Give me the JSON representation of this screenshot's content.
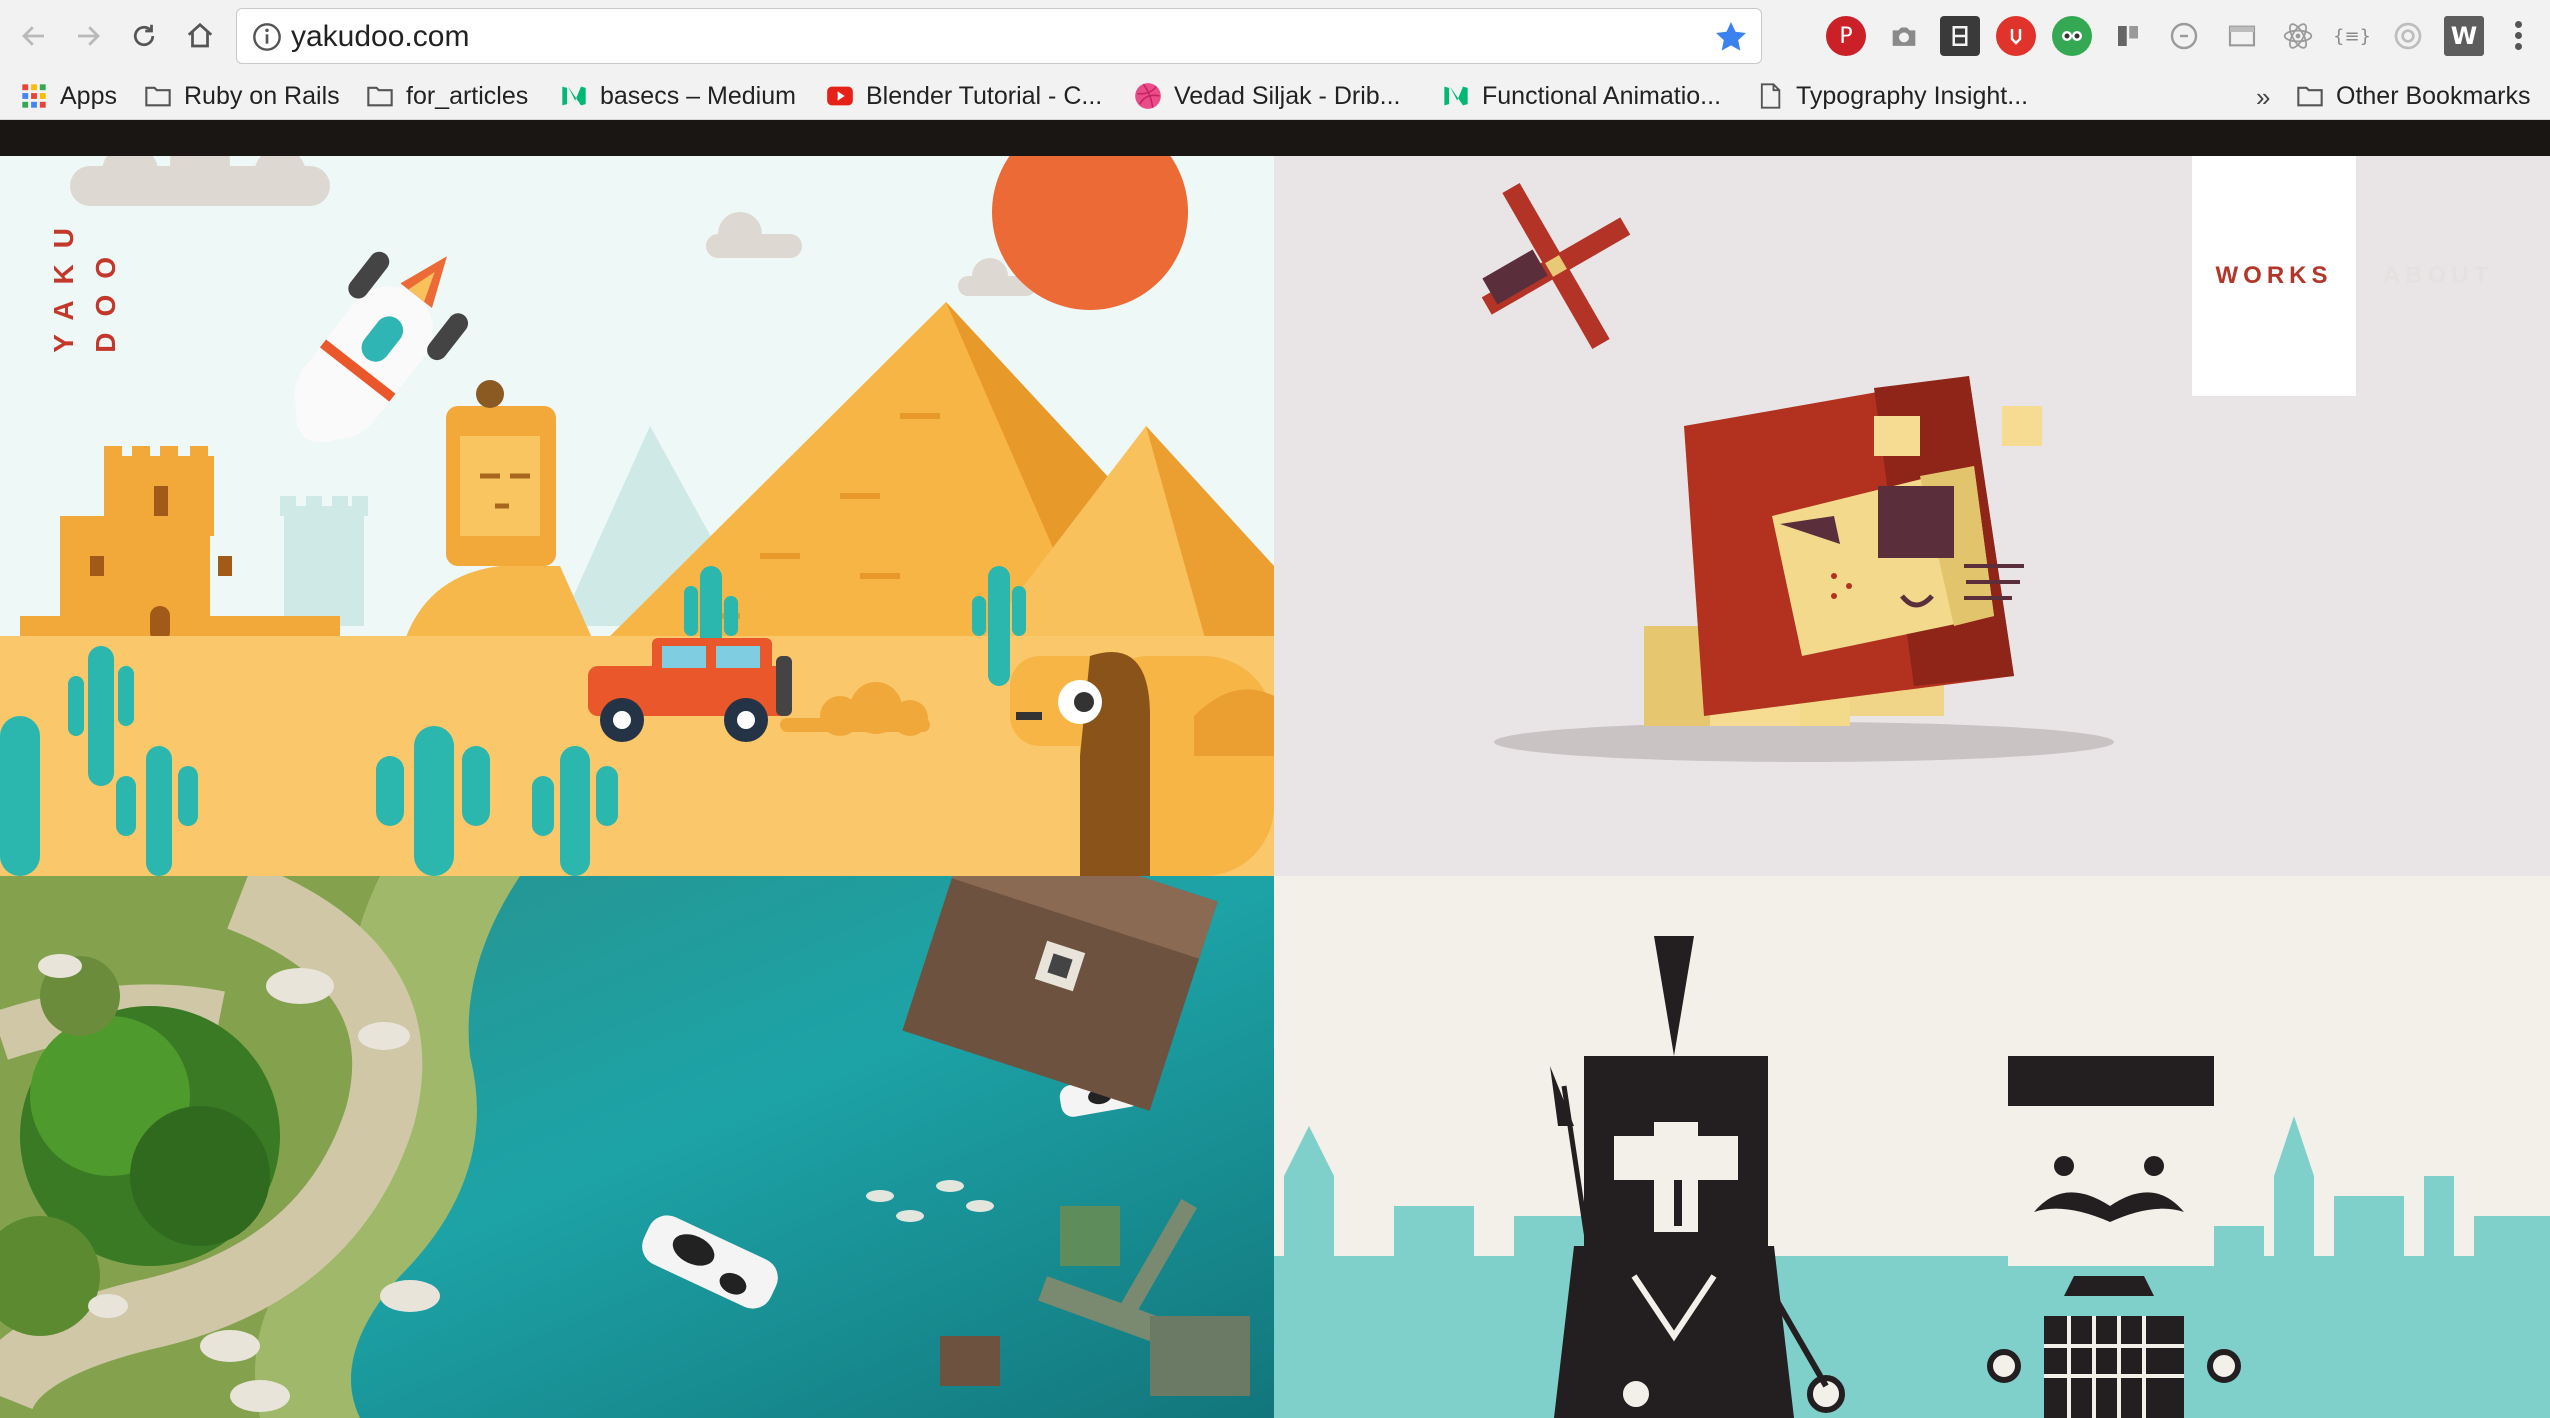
{
  "browser": {
    "url": "yakudoo.com",
    "bookmarks": [
      {
        "label": "Apps",
        "icon": "apps-grid-icon"
      },
      {
        "label": "Ruby on Rails",
        "icon": "folder-icon"
      },
      {
        "label": "for_articles",
        "icon": "folder-icon"
      },
      {
        "label": "basecs – Medium",
        "icon": "medium-icon"
      },
      {
        "label": "Blender Tutorial - C...",
        "icon": "youtube-icon"
      },
      {
        "label": "Vedad Siljak - Drib...",
        "icon": "dribbble-icon"
      },
      {
        "label": "Functional Animatio...",
        "icon": "medium-icon"
      },
      {
        "label": "Typography Insight...",
        "icon": "page-icon"
      }
    ],
    "overflow_label": "»",
    "other_bookmarks": "Other Bookmarks",
    "extensions": [
      "pinterest-icon",
      "camera-icon",
      "film-icon",
      "shield-icon",
      "tripadvisor-icon",
      "tile-icon",
      "reload-ext-icon",
      "window-icon",
      "react-icon",
      "json-icon",
      "circle-icon",
      "w-icon"
    ],
    "json_ext_glyph": "{≡}",
    "w_ext_glyph": "W"
  },
  "site": {
    "logo_left": "YAKU",
    "logo_right": "DOO",
    "nav": [
      {
        "label": "WORKS",
        "active": true
      },
      {
        "label": "ABOUT",
        "active": false
      }
    ]
  },
  "colors": {
    "accent_red": "#c4382b",
    "desert_sand": "#fbc76b",
    "desert_sky": "#eef8f7",
    "lion_bg": "#e9e5e6",
    "river": "#1da3a6",
    "paper": "#f3f0ea"
  }
}
